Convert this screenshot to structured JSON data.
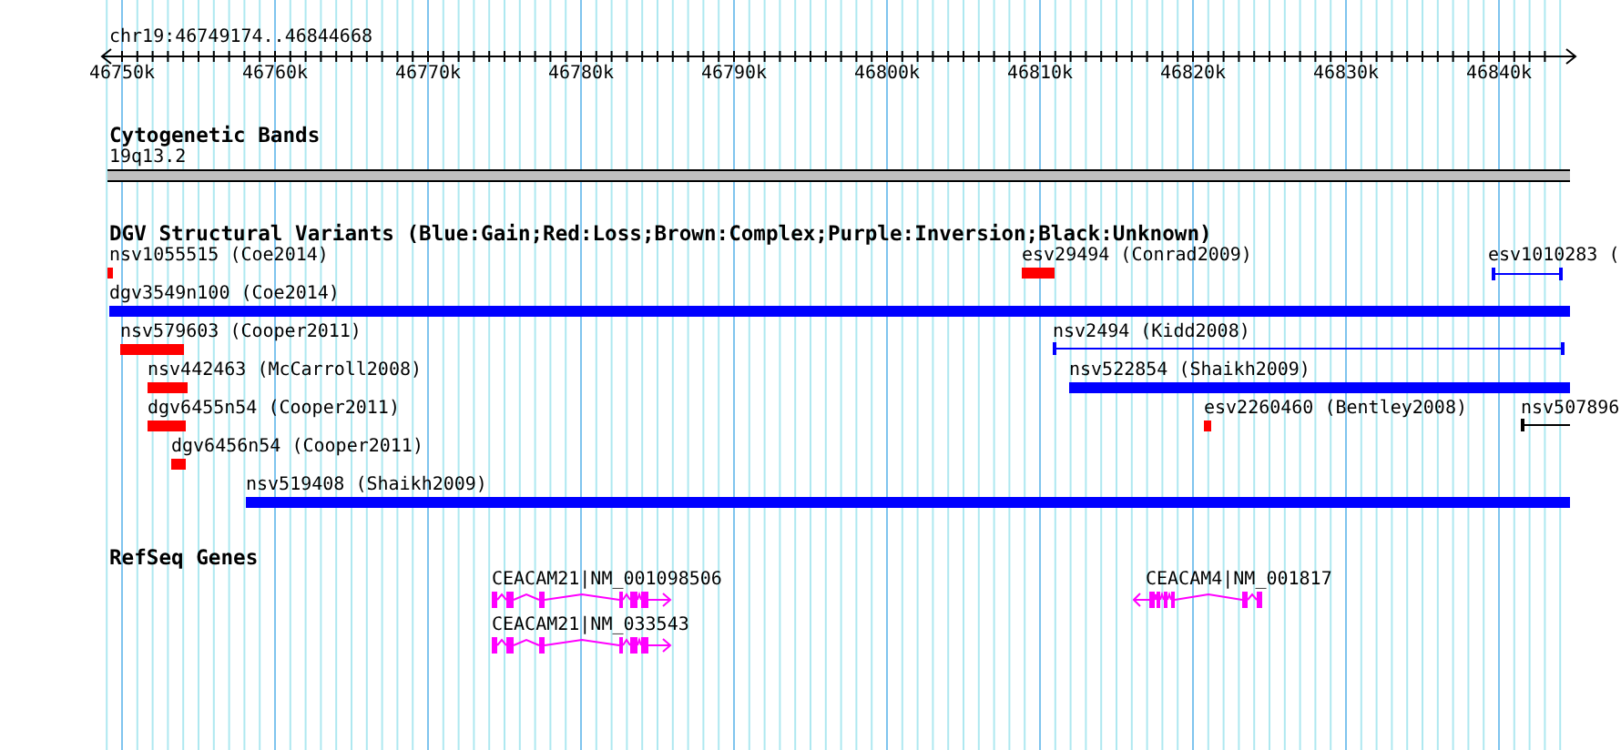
{
  "ruler": {
    "location": "chr19:46749174..46844668",
    "tick_labels": [
      "46750k",
      "46760k",
      "46770k",
      "46780k",
      "46790k",
      "46800k",
      "46810k",
      "46820k",
      "46830k",
      "46840k"
    ]
  },
  "tracks": [
    {
      "kind": "cytoband",
      "title": "Cytogenetic Bands",
      "features": [
        {
          "label": "19q13.2"
        }
      ]
    },
    {
      "kind": "variants",
      "title": "DGV Structural Variants (Blue:Gain;Red:Loss;Brown:Complex;Purple:Inversion;Black:Unknown)",
      "features": [
        {
          "label": "nsv1055515 (Coe2014)",
          "color": "#ff0000",
          "kind": "bar"
        },
        {
          "label": "esv29494 (Conrad2009)",
          "color": "#ff0000",
          "kind": "bar"
        },
        {
          "label": "esv1010283 (",
          "color": "#0000ff",
          "kind": "interval"
        },
        {
          "label": "dgv3549n100 (Coe2014)",
          "color": "#0000ff",
          "kind": "bar"
        },
        {
          "label": "nsv579603 (Cooper2011)",
          "color": "#ff0000",
          "kind": "bar"
        },
        {
          "label": "nsv2494 (Kidd2008)",
          "color": "#0000ff",
          "kind": "interval"
        },
        {
          "label": "nsv442463 (McCarroll2008)",
          "color": "#ff0000",
          "kind": "bar"
        },
        {
          "label": "nsv522854 (Shaikh2009)",
          "color": "#0000ff",
          "kind": "bar"
        },
        {
          "label": "dgv6455n54 (Cooper2011)",
          "color": "#ff0000",
          "kind": "bar"
        },
        {
          "label": "esv2260460 (Bentley2008)",
          "color": "#ff0000",
          "kind": "bar"
        },
        {
          "label": "nsv507896",
          "color": "#000000",
          "kind": "interval"
        },
        {
          "label": "dgv6456n54 (Cooper2011)",
          "color": "#ff0000",
          "kind": "bar"
        },
        {
          "label": "nsv519408 (Shaikh2009)",
          "color": "#0000ff",
          "kind": "bar"
        }
      ]
    },
    {
      "kind": "genes",
      "title": "RefSeq Genes",
      "features": [
        {
          "label": "CEACAM21|NM_001098506",
          "kind": "forward"
        },
        {
          "label": "CEACAM21|NM_033543",
          "kind": "forward"
        },
        {
          "label": "CEACAM4|NM_001817",
          "kind": "reverse"
        }
      ]
    }
  ]
}
